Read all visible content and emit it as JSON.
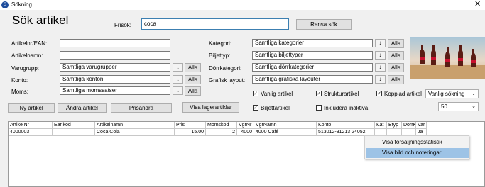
{
  "window": {
    "title": "Sökning",
    "close_glyph": "✕",
    "icon_letter": "S"
  },
  "heading": "Sök artikel",
  "search": {
    "label": "Frisök:",
    "value": "coca",
    "clear_button": "Rensa sök"
  },
  "left_fields": [
    {
      "label": "Artikelnr/EAN:",
      "value": ""
    },
    {
      "label": "Artikelnamn:",
      "value": ""
    }
  ],
  "left_combos": [
    {
      "label": "Varugrupp:",
      "value": "Samtliga varugrupper",
      "all": "Alla"
    },
    {
      "label": "Konto:",
      "value": "Samtliga konton",
      "all": "Alla"
    },
    {
      "label": "Moms:",
      "value": "Samtliga momssatser",
      "all": "Alla"
    }
  ],
  "right_combos": [
    {
      "label": "Kategori:",
      "value": "Samtliga kategorier",
      "all": "Alla"
    },
    {
      "label": "Biljettyp:",
      "value": "Samtliga biljettyper",
      "all": "Alla"
    },
    {
      "label": "Dörrkategori:",
      "value": "Samtliga dörrkategorier",
      "all": "Alla"
    },
    {
      "label": "Grafisk layout:",
      "value": "Samtliga grafiska layouter",
      "all": "Alla"
    }
  ],
  "checkboxes": [
    {
      "label": "Vanlig artikel",
      "checked": true
    },
    {
      "label": "Strukturartikel",
      "checked": true
    },
    {
      "label": "Kopplad artikel",
      "checked": true
    },
    {
      "label": "Biljettartikel",
      "checked": true
    },
    {
      "label": "Inkludera inaktiva",
      "checked": false
    }
  ],
  "search_mode": {
    "value": "Vanlig sökning"
  },
  "result_count": {
    "value": "50"
  },
  "buttons": {
    "new": "Ny artikel",
    "edit": "Ändra artikel",
    "price": "Prisändra",
    "stock": "Visa lagerartiklar"
  },
  "table": {
    "columns": [
      "ArtikelNr",
      "Eankod",
      "Artikelnamn",
      "Pris",
      "Momskod",
      "VgrNr",
      "VgrNamn",
      "Konto",
      "Kat",
      "Btyp",
      "DörrK",
      "Var"
    ],
    "rows": [
      [
        "4000003",
        "",
        "Coca Cola",
        "15.00",
        "2",
        "4000",
        "4000 Café",
        "513012-31213 24052",
        "",
        "",
        "",
        "Ja"
      ]
    ]
  },
  "context_menu": {
    "items": [
      {
        "label": "Visa försäljningsstatistik",
        "highlighted": false
      },
      {
        "label": "Visa bild och noteringar",
        "highlighted": true
      }
    ]
  },
  "glyphs": {
    "down_arrow": "↓",
    "dropdown": "⌄",
    "check": "✓"
  },
  "colors": {
    "search_border": "#3c7fb1",
    "menu_highlight": "#9dc3e6",
    "app_icon": "#1f4e9c"
  }
}
